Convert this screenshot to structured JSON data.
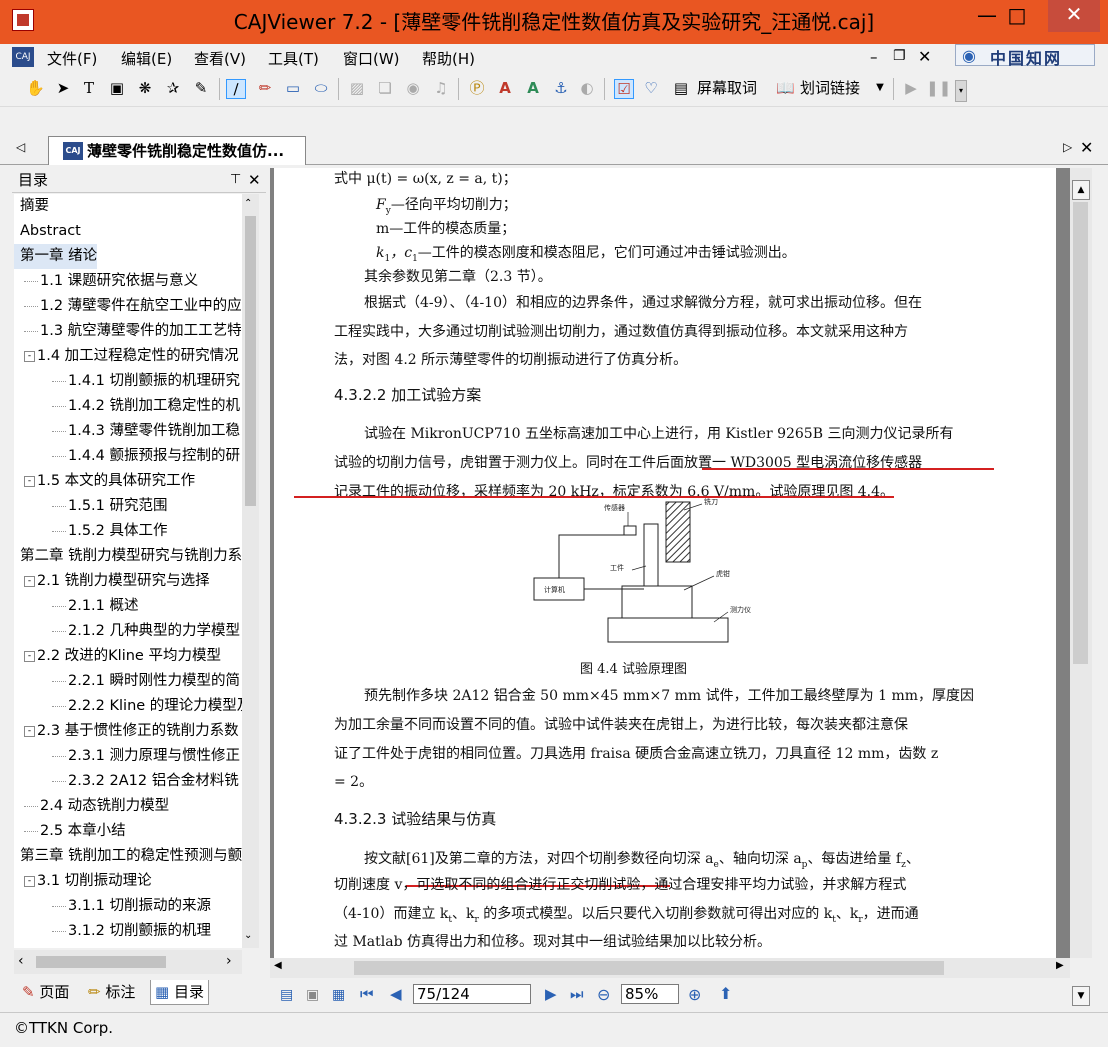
{
  "window": {
    "title": "CAJViewer 7.2 - [薄壁零件铣削稳定性数值仿真及实验研究_汪通悦.caj]",
    "minimize_icon": "minimize-icon",
    "maximize_icon": "maximize-icon",
    "close_icon": "close-icon",
    "accent_color": "#e95622"
  },
  "menubar": {
    "items": [
      "文件(F)",
      "编辑(E)",
      "查看(V)",
      "工具(T)",
      "窗口(W)",
      "帮助(H)"
    ],
    "cnki_logo": "中国知网"
  },
  "toolbar": {
    "screen_ocr_label": "屏幕取词",
    "word_link_label": "划词链接"
  },
  "tabs": {
    "document_tab": "薄壁零件铣削稳定性数值仿..."
  },
  "toc": {
    "title": "目录",
    "items": [
      {
        "label": "摘要",
        "level": 0
      },
      {
        "label": "Abstract",
        "level": 0
      },
      {
        "label": "第一章 绪论",
        "level": 0,
        "selected": true
      },
      {
        "label": "1.1 课题研究依据与意义",
        "level": 1
      },
      {
        "label": "1.2 薄壁零件在航空工业中的应",
        "level": 1
      },
      {
        "label": "1.3 航空薄壁零件的加工工艺特",
        "level": 1
      },
      {
        "label": "1.4 加工过程稳定性的研究情况",
        "level": 1,
        "toggle": "-"
      },
      {
        "label": "1.4.1 切削颤振的机理研究",
        "level": 2
      },
      {
        "label": "1.4.2 铣削加工稳定性的机",
        "level": 2
      },
      {
        "label": "1.4.3 薄壁零件铣削加工稳",
        "level": 2
      },
      {
        "label": "1.4.4 颤振预报与控制的研",
        "level": 2
      },
      {
        "label": "1.5 本文的具体研究工作",
        "level": 1,
        "toggle": "-"
      },
      {
        "label": "1.5.1 研究范围",
        "level": 2
      },
      {
        "label": "1.5.2 具体工作",
        "level": 2
      },
      {
        "label": "第二章 铣削力模型研究与铣削力系",
        "level": 0
      },
      {
        "label": "2.1 铣削力模型研究与选择",
        "level": 1,
        "toggle": "-"
      },
      {
        "label": "2.1.1 概述",
        "level": 2
      },
      {
        "label": "2.1.2 几种典型的力学模型",
        "level": 2
      },
      {
        "label": "2.2 改进的Kline 平均力模型",
        "level": 1,
        "toggle": "-"
      },
      {
        "label": "2.2.1 瞬时刚性力模型的简",
        "level": 2
      },
      {
        "label": "2.2.2 Kline 的理论力模型及",
        "level": 2
      },
      {
        "label": "2.3 基于惯性修正的铣削力系数",
        "level": 1,
        "toggle": "-"
      },
      {
        "label": "2.3.1 测力原理与惯性修正",
        "level": 2
      },
      {
        "label": "2.3.2 2A12 铝合金材料铣",
        "level": 2
      },
      {
        "label": "2.4 动态铣削力模型",
        "level": 1
      },
      {
        "label": "2.5 本章小结",
        "level": 1
      },
      {
        "label": "第三章 铣削加工的稳定性预测与颤",
        "level": 0
      },
      {
        "label": "3.1 切削振动理论",
        "level": 1,
        "toggle": "-"
      },
      {
        "label": "3.1.1 切削振动的来源",
        "level": 2
      },
      {
        "label": "3.1.2 切削颤振的机理",
        "level": 2
      }
    ],
    "bottom_tabs": [
      "页面",
      "标注",
      "目录"
    ]
  },
  "document": {
    "lines": {
      "l1": "式中  μ(t) = ω(x, z = a, t)；",
      "l2": "F",
      "l2b": "—径向平均切削力；",
      "l3": "m—工件的模态质量；",
      "l4": "k",
      "l4b": "，c",
      "l4c": "—工件的模态刚度和模态阻尼，它们可通过冲击锤试验测出。",
      "l5": "其余参数见第二章（2.3 节）。",
      "p1a": "根据式（4-9）、（4-10）和相应的边界条件，通过求解微分方程，就可求出振动位移。但在",
      "p1b": "工程实践中，大多通过切削试验测出切削力，通过数值仿真得到振动位移。本文就采用这种方",
      "p1c": "法，对图 4.2 所示薄壁零件的切削振动进行了仿真分析。",
      "h1": "4.3.2.2 加工试验方案",
      "p2a": "试验在 MikronUCP710 五坐标高速加工中心上进行，用 Kistler 9265B 三向测力仪记录所有",
      "p2b": "试验的切削力信号，虎钳置于测力仪上。同时在工件后面放置一 WD3005 型电涡流位移传感器",
      "p2c": "记录工件的振动位移，采样频率为 20 kHz，标定系数为 6.6 V/mm。试验原理见图 4.4。",
      "fig_caption": "图 4.4    试验原理图",
      "fig_sensor": "传感器",
      "fig_cutter": "铣刀",
      "fig_workpiece": "工件",
      "fig_vise": "虎钳",
      "fig_computer": "计算机",
      "fig_dynamometer": "测力仪",
      "p3a": "预先制作多块 2A12 铝合金 50 mm×45 mm×7 mm 试件，工件加工最终壁厚为 1 mm，厚度因",
      "p3b": "为加工余量不同而设置不同的值。试验中试件装夹在虎钳上，为进行比较，每次装夹都注意保",
      "p3c": "证了工件处于虎钳的相同位置。刀具选用 fraisa 硬质合金高速立铣刀，刀具直径 12 mm，齿数 z",
      "p3d": "= 2。",
      "h2": "4.3.2.3 试验结果与仿真",
      "p4a": "按文献[61]及第二章的方法，对四个切削参数径向切深 a",
      "p4a2": "、轴向切深 a",
      "p4a3": "、每齿进给量 f",
      "p4a4": "、",
      "p4b": "切削速度 v，可选取不同的组合进行正交切削试验，通过合理安排平均力试验，并求解方程式",
      "p4c": "（4-10）而建立 k",
      "p4c2": "、k",
      "p4c3": " 的多项式模型。以后只要代入切削参数就可得出对应的 k",
      "p4c4": "、k",
      "p4c5": "，进而通",
      "p4d": "过 Matlab 仿真得出力和位移。现对其中一组试验结果加以比较分析。"
    },
    "annotation_color": "#d42020"
  },
  "navigation": {
    "page_value": "75/124",
    "zoom_value": "85%"
  },
  "statusbar": {
    "copyright": "©TTKN Corp."
  }
}
